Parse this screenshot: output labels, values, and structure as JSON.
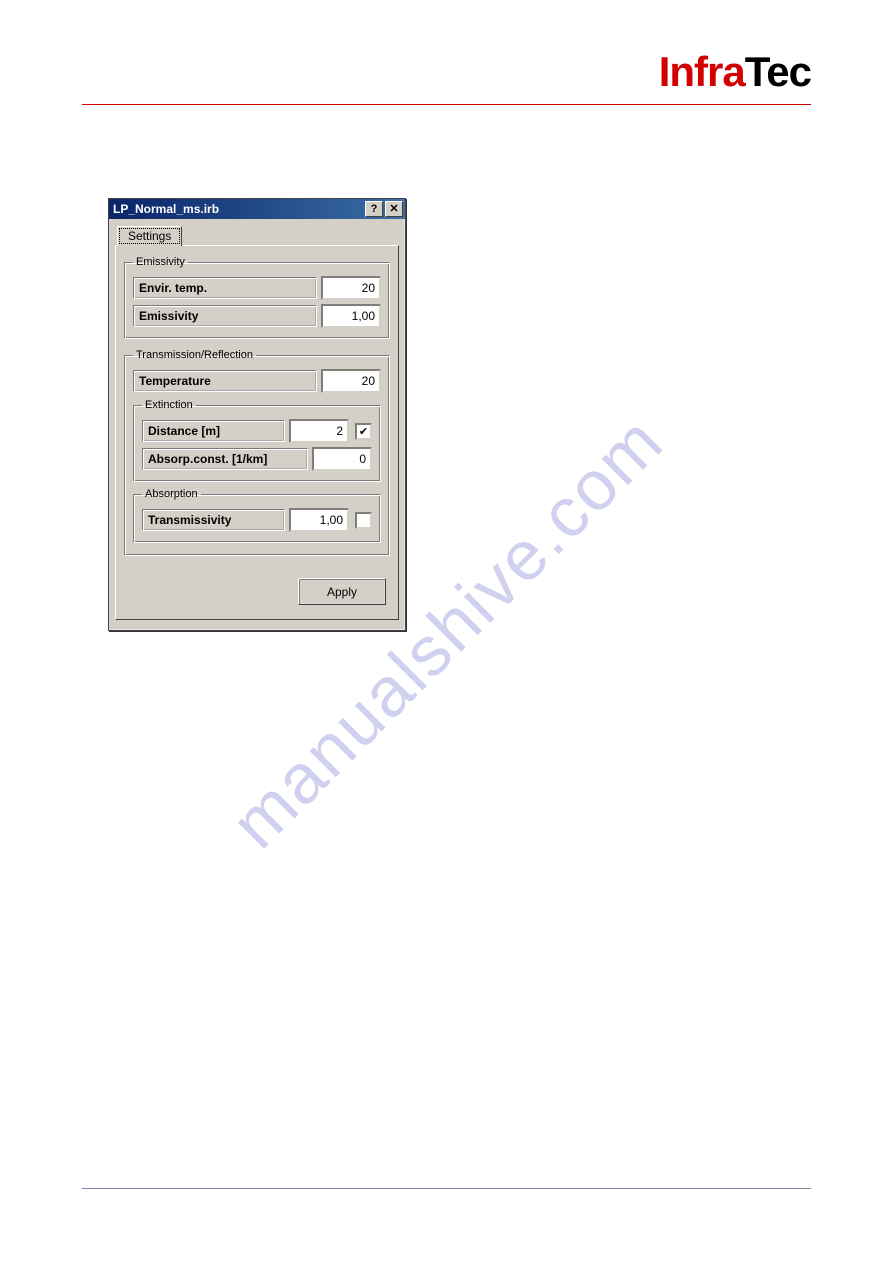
{
  "brand": {
    "part1": "Infra",
    "part2": "Tec"
  },
  "watermark": "manualshive.com",
  "dialog": {
    "title": "LP_Normal_ms.irb",
    "help_btn": "?",
    "close_btn": "✕",
    "tab_label": "Settings",
    "emissivity": {
      "legend": "Emissivity",
      "envir_temp_label": "Envir. temp.",
      "envir_temp_value": "20",
      "emissivity_label": "Emissivity",
      "emissivity_value": "1,00"
    },
    "trans_refl": {
      "legend": "Transmission/Reflection",
      "temperature_label": "Temperature",
      "temperature_value": "20",
      "extinction": {
        "legend": "Extinction",
        "distance_label": "Distance [m]",
        "distance_value": "2",
        "distance_checked": "✔",
        "absorp_label": "Absorp.const. [1/km]",
        "absorp_value": "0"
      },
      "absorption": {
        "legend": "Absorption",
        "transmissivity_label": "Transmissivity",
        "transmissivity_value": "1,00",
        "transmissivity_checked": ""
      }
    },
    "apply_label": "Apply"
  }
}
